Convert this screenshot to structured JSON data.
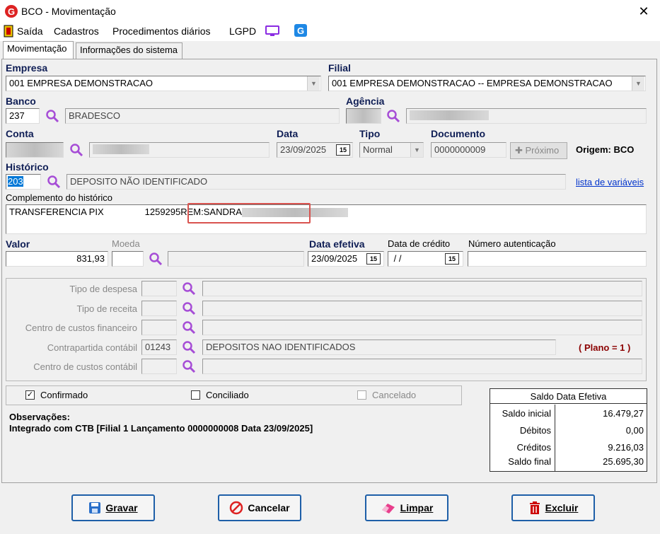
{
  "window": {
    "title": "BCO - Movimentação",
    "close": "✕"
  },
  "menu": [
    "Saída",
    "Cadastros",
    "Procedimentos diários",
    "LGPD"
  ],
  "tabs": [
    "Movimentação",
    "Informações do sistema"
  ],
  "empresa": {
    "label": "Empresa",
    "value": "001 EMPRESA DEMONSTRACAO"
  },
  "filial": {
    "label": "Filial",
    "value": "001 EMPRESA DEMONSTRACAO -- EMPRESA DEMONSTRACAO"
  },
  "banco": {
    "label": "Banco",
    "code": "237",
    "name": "BRADESCO"
  },
  "agencia": {
    "label": "Agência"
  },
  "conta": {
    "label": "Conta"
  },
  "data": {
    "label": "Data",
    "value": "23/09/2025"
  },
  "tipo": {
    "label": "Tipo",
    "value": "Normal"
  },
  "documento": {
    "label": "Documento",
    "value": "0000000009",
    "proximo": "Próximo"
  },
  "origem": "Origem: BCO",
  "historico": {
    "label": "Histórico",
    "code": "203",
    "desc": "DEPOSITO NÃO IDENTIFICADO",
    "link": "lista de variáveis"
  },
  "complemento": {
    "label": "Complemento do histórico",
    "text1": "TRANSFERENCIA PIX",
    "text2": "1259295REM:",
    "text3": "SANDRA"
  },
  "valor": {
    "label": "Valor",
    "value": "831,93"
  },
  "moeda": {
    "label": "Moeda"
  },
  "data_efetiva": {
    "label": "Data efetiva",
    "value": "23/09/2025"
  },
  "data_credito": {
    "label": "Data de crédito",
    "value": " / /"
  },
  "numero_autenticacao": {
    "label": "Número autenticação"
  },
  "detalhes": {
    "tipo_despesa": "Tipo de despesa",
    "tipo_receita": "Tipo de receita",
    "cc_financeiro": "Centro de custos financeiro",
    "contrapartida": "Contrapartida contábil",
    "contrapartida_code": "01243",
    "contrapartida_desc": "DEPOSITOS NAO IDENTIFICADOS",
    "plano": "( Plano = 1 )",
    "cc_contabil": "Centro de custos contábil"
  },
  "status": {
    "confirmado": "Confirmado",
    "conciliado": "Conciliado",
    "cancelado": "Cancelado",
    "confirmado_checked": "✓"
  },
  "observacoes": {
    "title": "Observações:",
    "text": "Integrado com CTB [Filial 1 Lançamento 0000000008 Data 23/09/2025]"
  },
  "saldo": {
    "title": "Saldo Data Efetiva",
    "rows": [
      {
        "label": "Saldo inicial",
        "value": "16.479,27"
      },
      {
        "label": "Débitos",
        "value": "0,00"
      },
      {
        "label": "Créditos",
        "value": "9.216,03"
      },
      {
        "label": "Saldo final",
        "value": "25.695,30"
      }
    ]
  },
  "buttons": {
    "gravar": "Gravar",
    "cancelar": "Cancelar",
    "limpar": "Limpar",
    "excluir": "Excluir"
  },
  "colors": {
    "accent": "#1e5fa8",
    "label_blue": "#0f1e55",
    "plano_red": "#8b0000"
  }
}
